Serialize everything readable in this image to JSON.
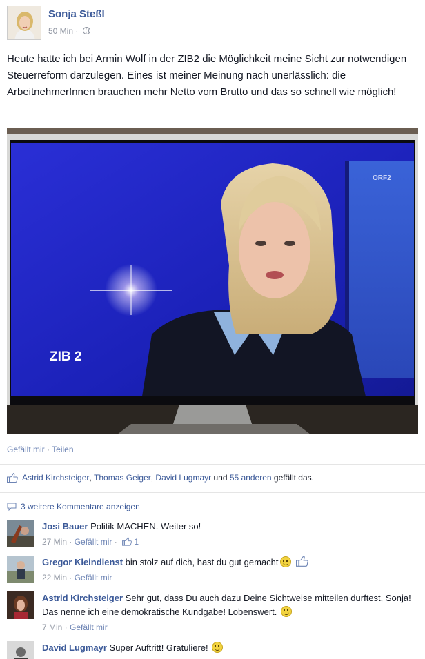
{
  "post": {
    "author": "Sonja Steßl",
    "time": "50 Min",
    "text": "Heute hatte ich bei Armin Wolf in der ZIB2 die Möglichkeit meine Sicht zur notwendigen Steuerreform darzulegen. Eines ist meiner Meinung nach unerlässlich: die ArbeitnehmerInnen brauchen mehr Netto vom Brutto und das so schnell wie möglich!",
    "photo": {
      "tv_logo": "ZIB 2",
      "channel_logo": "ORF2"
    },
    "actions": {
      "like": "Gefällt mir",
      "separator": "·",
      "share": "Teilen"
    },
    "likes": {
      "name1": "Astrid Kirchsteiger",
      "name2": "Thomas Geiger",
      "name3": "David Lugmayr",
      "und": "und",
      "others": "55 anderen",
      "suffix": "gefällt das."
    },
    "more_comments": "3 weitere Kommentare anzeigen"
  },
  "comments": [
    {
      "name": "Josi Bauer",
      "text": "Politik MACHEN. Weiter so!",
      "time": "27 Min",
      "like": "Gefällt mir",
      "like_count": "1"
    },
    {
      "name": "Gregor Kleindienst",
      "text": "bin stolz auf dich, hast du gut gemacht",
      "time": "22 Min",
      "like": "Gefällt mir"
    },
    {
      "name": "Astrid Kirchsteiger",
      "text": "Sehr gut, dass Du auch dazu Deine Sichtweise mitteilen durftest, Sonja! Das nenne ich eine demokratische Kundgabe! Lobenswert.",
      "time": "7 Min",
      "like": "Gefällt mir"
    },
    {
      "name": "David Lugmayr",
      "text": "Super Auftritt! Gratuliere!"
    }
  ],
  "colors": {
    "link_blue": "#3b5998",
    "meta_gray": "#9197a3",
    "studio_blue": "#1d24c8"
  }
}
